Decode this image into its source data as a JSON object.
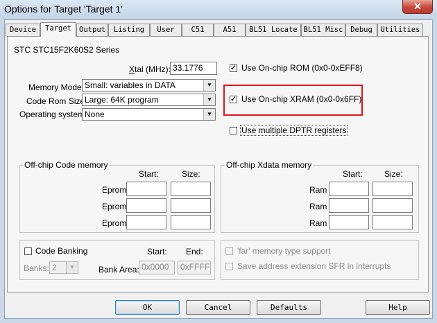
{
  "window": {
    "title": "Options for Target 'Target 1'",
    "close_glyph": "✕"
  },
  "tabs": [
    {
      "label": "Device",
      "active": false
    },
    {
      "label": "Target",
      "active": true
    },
    {
      "label": "Output",
      "active": false
    },
    {
      "label": "Listing",
      "active": false
    },
    {
      "label": "User",
      "active": false
    },
    {
      "label": "C51",
      "active": false
    },
    {
      "label": "A51",
      "active": false
    },
    {
      "label": "BL51 Locate",
      "active": false
    },
    {
      "label": "BL51 Misc",
      "active": false
    },
    {
      "label": "Debug",
      "active": false
    },
    {
      "label": "Utilities",
      "active": false
    }
  ],
  "device_name": "STC STC15F2K60S2 Series",
  "xtal": {
    "label_accel": "X",
    "label_rest": "tal (MHz):",
    "value": "33.1776"
  },
  "memory_model": {
    "label": "Memory Model:",
    "value": "Small: variables in DATA"
  },
  "code_rom_size": {
    "label": "Code Rom Size:",
    "value": "Large: 64K program"
  },
  "operating_system": {
    "label": "Operating system:",
    "value": "None"
  },
  "options": {
    "onchip_rom": {
      "label": "Use On-chip ROM (0x0-0xEFF8)",
      "checked": true
    },
    "onchip_xram": {
      "label": "Use On-chip XRAM (0x0-0x6FF)",
      "checked": true
    },
    "multiple_dptr": {
      "label": "Use multiple DPTR registers",
      "checked": false
    }
  },
  "offchip_code": {
    "title": "Off-chip Code memory",
    "start_header": "Start:",
    "size_header": "Size:",
    "rows": [
      {
        "label": "Eprom",
        "start": "",
        "size": ""
      },
      {
        "label": "Eprom",
        "start": "",
        "size": ""
      },
      {
        "label": "Eprom",
        "start": "",
        "size": ""
      }
    ]
  },
  "offchip_xdata": {
    "title": "Off-chip Xdata memory",
    "start_header": "Start:",
    "size_header": "Size:",
    "rows": [
      {
        "label": "Ram",
        "start": "",
        "size": ""
      },
      {
        "label": "Ram",
        "start": "",
        "size": ""
      },
      {
        "label": "Ram",
        "start": "",
        "size": ""
      }
    ]
  },
  "code_banking": {
    "label": "Code Banking",
    "checked": false,
    "start_header": "Start:",
    "end_header": "End:",
    "banks_label": "Banks:",
    "banks_value": "2",
    "bank_area_label": "Bank Area:",
    "bank_area_start": "0x0000",
    "bank_area_end": "0xFFFF"
  },
  "far_options": {
    "far_memory": {
      "label": "'far' memory type support",
      "checked": false
    },
    "save_address": {
      "label": "Save address extension SFR in interrupts",
      "checked": false
    }
  },
  "buttons": {
    "ok": "OK",
    "cancel": "Cancel",
    "defaults": "Defaults",
    "help": "Help"
  },
  "colors": {
    "highlight_box": "#e0141a"
  }
}
